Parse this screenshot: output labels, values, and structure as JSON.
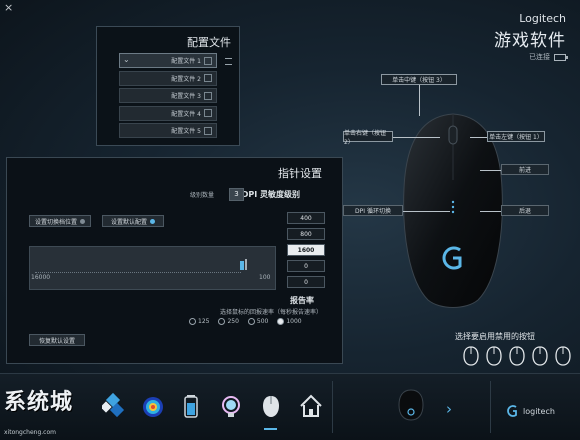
{
  "window": {
    "close_label": "×"
  },
  "brand": {
    "name_en": "Logitech",
    "name_cn": "游戏软件",
    "connection": "已连接"
  },
  "profiles": {
    "title": "配置文件",
    "items": [
      {
        "label": "配置文件 1",
        "active": true
      },
      {
        "label": "配置文件 2",
        "active": false
      },
      {
        "label": "配置文件 3",
        "active": false
      },
      {
        "label": "配置文件 4",
        "active": false
      },
      {
        "label": "配置文件 5",
        "active": false
      }
    ]
  },
  "pointer": {
    "title": "指针设置",
    "dpi_label": "DPI 灵敏度级别",
    "dpi_count": "3",
    "dpi_unit": "级别数量",
    "btn_default": "设置默认配置",
    "btn_shift": "设置切换档位置",
    "dpi_values": [
      "400",
      "800",
      "1600",
      "0",
      "0"
    ],
    "dpi_selected": 2,
    "slider_min": "100",
    "slider_max": "16000",
    "report": {
      "title": "报告率",
      "desc": "选择鼠标的回报速率（每秒报告速率）",
      "rates": [
        {
          "label": "125",
          "on": false
        },
        {
          "label": "250",
          "on": false
        },
        {
          "label": "500",
          "on": false
        },
        {
          "label": "1000",
          "on": true
        }
      ]
    },
    "btn_restore": "恢复默认设置"
  },
  "mouse": {
    "callouts": {
      "middle": "单击中键（按钮 3）",
      "right": "单击右键（按钮 2）",
      "left": "单击左键（按钮 1）",
      "forward": "前进",
      "back": "后退",
      "dpi_cycle": "DPI 循环切换"
    }
  },
  "chooser": {
    "label": "选择要启用禁用的按钮"
  },
  "watermark": {
    "text": "系统城",
    "url": "xitongcheng.com"
  },
  "toolbar": {
    "items": [
      {
        "name": "settings-gear-icon"
      },
      {
        "name": "heatmap-icon"
      },
      {
        "name": "battery-icon"
      },
      {
        "name": "lighting-icon"
      },
      {
        "name": "pointer-mouse-icon"
      },
      {
        "name": "home-icon"
      }
    ]
  },
  "colors": {
    "accent": "#5bb7e8",
    "panel_bg": "#0b1117"
  }
}
